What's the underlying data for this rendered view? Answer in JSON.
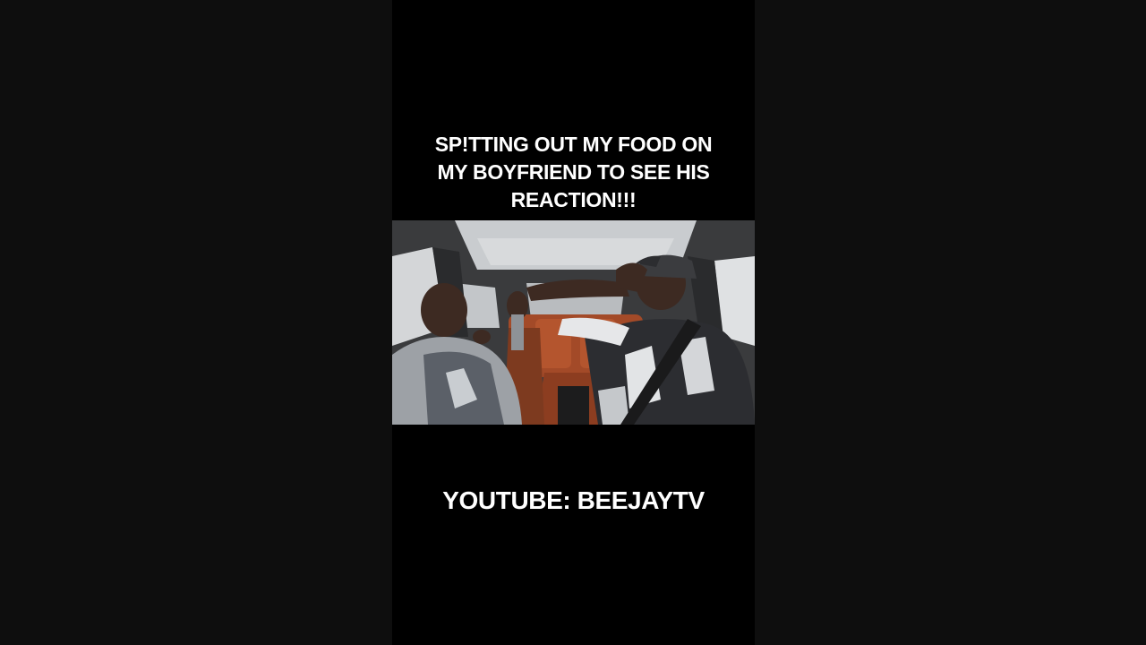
{
  "video": {
    "caption_top": "SP!TTING OUT MY FOOD ON\nMY BOYFRIEND TO SEE HIS\nREACTION!!!",
    "caption_bottom": "YOUTUBE: BEEJAYTV"
  },
  "colors": {
    "page_background": "#0e0e0e",
    "video_background": "#000000",
    "caption_text": "#ffffff",
    "car_interior_accent": "#b4552e"
  }
}
